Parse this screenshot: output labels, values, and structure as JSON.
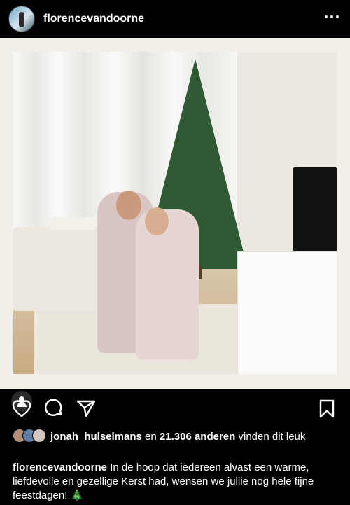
{
  "post": {
    "username": "florencevandoorne"
  },
  "likes": {
    "user": "jonah_hulselmans",
    "middle": "en",
    "count": "21.306 anderen",
    "suffix": "vinden dit leuk"
  },
  "caption": {
    "username": "florencevandoorne",
    "text": "In de hoop dat iedereen alvast een warme, liefdevolle en gezellige Kerst had, wensen we jullie nog hele fijne feestdagen! 🎄"
  },
  "icons": {
    "more": "more-icon",
    "like": "heart-icon",
    "comment": "comment-icon",
    "share": "share-icon",
    "save": "bookmark-icon",
    "tag": "tagged-user-icon"
  },
  "colors": {
    "background": "#000000",
    "text": "#ffffff"
  }
}
